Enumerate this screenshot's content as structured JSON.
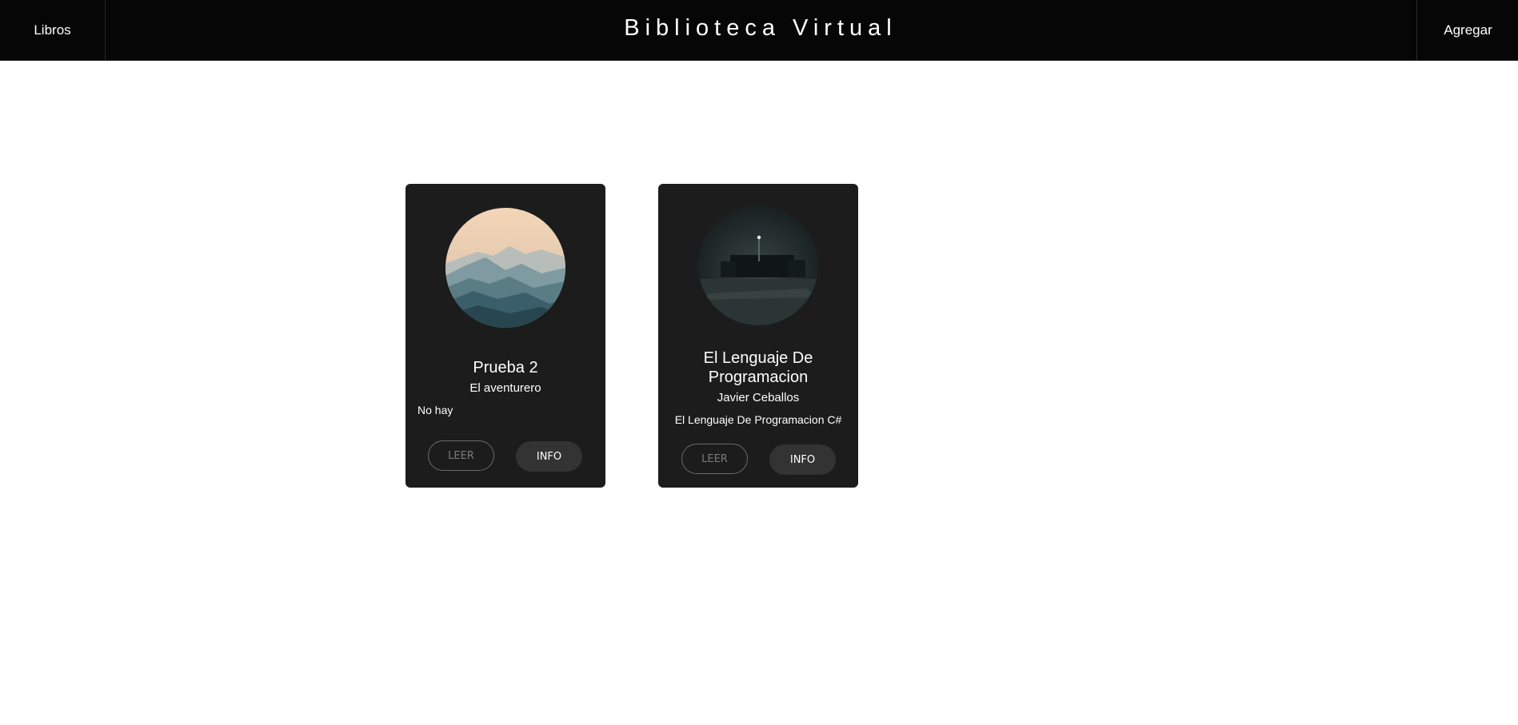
{
  "nav": {
    "left_link": "Libros",
    "brand": "Biblioteca Virtual",
    "right_link": "Agregar"
  },
  "books": [
    {
      "title": "Prueba 2",
      "author": "El aventurero",
      "description": "No hay",
      "read_label": "LEER",
      "info_label": "INFO",
      "cover_icon": "mountains-image"
    },
    {
      "title": "El Lenguaje De Programacion",
      "author": "Javier Ceballos",
      "description": "El Lenguaje De Programacion C#",
      "read_label": "LEER",
      "info_label": "INFO",
      "cover_icon": "night-street-image"
    }
  ],
  "colors": {
    "navbar_bg": "#060606",
    "card_bg": "#1c1c1c",
    "info_button_bg": "#333333"
  }
}
